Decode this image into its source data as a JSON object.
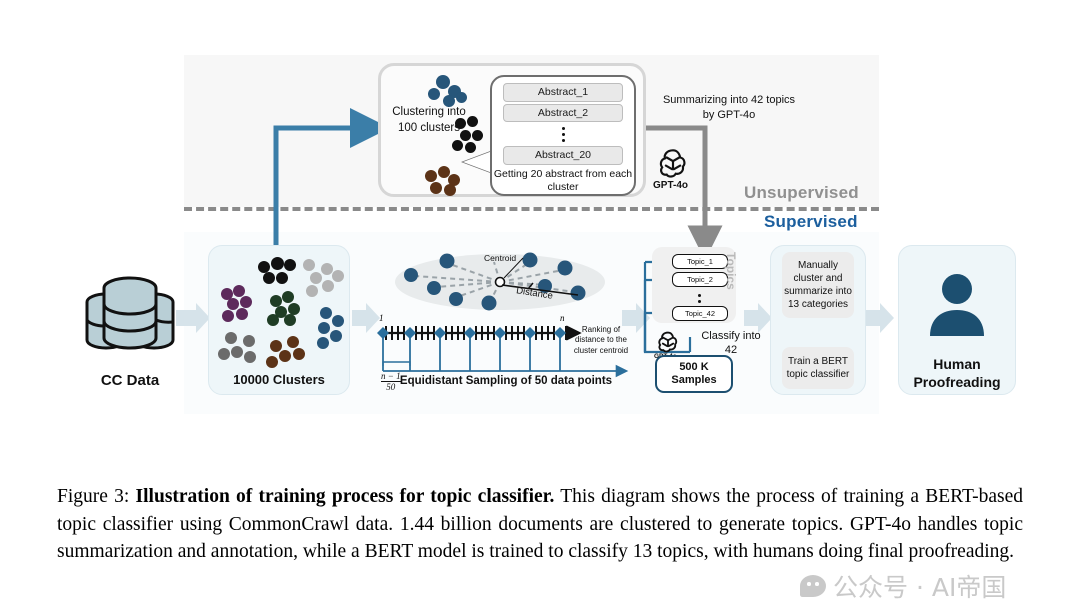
{
  "figure": {
    "sections": {
      "unsupervised_label": "Unsupervised",
      "supervised_label": "Supervised"
    },
    "top": {
      "clustering_text": "Clustering into 100 clusters",
      "abstracts": [
        "Abstract_1",
        "Abstract_2",
        "Abstract_20"
      ],
      "bubble_caption": "Getting 20 abstract from each cluster",
      "summarizing_text": "Summarizing into 42 topics by GPT-4o",
      "gpt_label": "GPT-4o"
    },
    "bottom": {
      "cc_data_label": "CC Data",
      "clusters_label": "10000 Clusters",
      "centroid_label": "Centroid",
      "distance_label": "Distance",
      "axis_start_label": "1",
      "axis_end_label": "n",
      "ranking_text": "Ranking of distance to the cluster centroid",
      "fraction_numerator": "n − 1",
      "fraction_denominator": "50",
      "sampling_caption": "Equidistant Sampling of 50 data points",
      "topics": [
        "Topic_1",
        "Topic_2",
        "Topic_42"
      ],
      "topics_side_label": "Topics",
      "gpt_label": "GPT-4o",
      "classify_text": "Classify into 42",
      "samples_line1": "500 K",
      "samples_line2": "Samples",
      "manual_box_text": "Manually cluster and summarize into 13 categories",
      "bert_box_text": "Train a BERT topic classifier",
      "human_label": "Human Proofreading"
    },
    "colors": {
      "accent_blue": "#3b7ea8",
      "dark_blue": "#1c4f70",
      "supervised_blue": "#1c5f9e",
      "unsupervised_gray": "#909090",
      "stage_fill": "#eef6f9",
      "cluster_black": "#111111",
      "cluster_lightgray": "#b3b3b3",
      "cluster_purple": "#5d2a5c",
      "cluster_green": "#1f3d25",
      "cluster_gray": "#6b6b6b",
      "cluster_brown": "#5c3317",
      "cluster_steelblue": "#27567a"
    }
  },
  "caption": {
    "figure_number": "Figure 3:",
    "bold_title": "Illustration of training process for topic classifier.",
    "body": "This diagram shows the process of training a BERT-based topic classifier using CommonCrawl data. 1.44 billion documents are clustered to generate topics. GPT-4o handles topic summarization and annotation, while a BERT model is trained to classify 13 topics, with humans doing final proofreading."
  },
  "watermark": {
    "text": "公众号 · AI帝国"
  }
}
